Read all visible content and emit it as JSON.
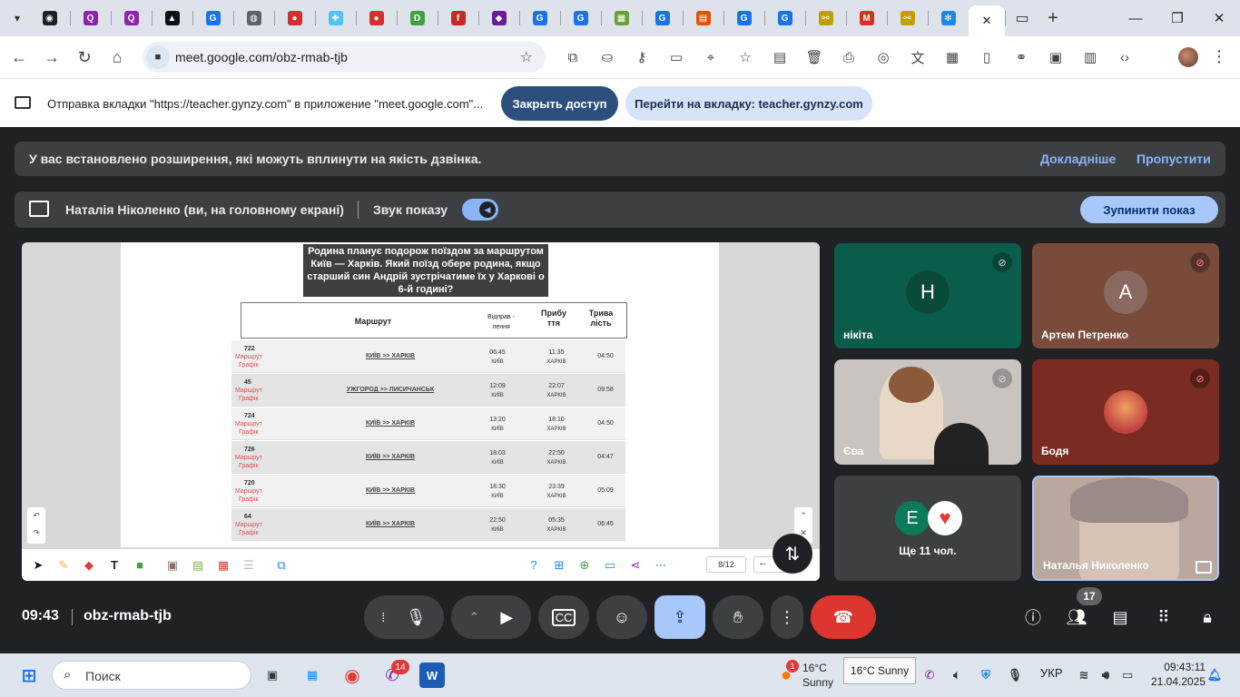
{
  "browser": {
    "tabs": [
      {
        "icon": "robot-icon",
        "glyph": "◉",
        "color": "#202124"
      },
      {
        "icon": "quiz-icon",
        "glyph": "Q",
        "color": "#8e24aa"
      },
      {
        "icon": "quiz-icon",
        "glyph": "Q",
        "color": "#8e24aa"
      },
      {
        "icon": "triangle-icon",
        "glyph": "▲",
        "color": "#111111"
      },
      {
        "icon": "g-icon",
        "glyph": "G",
        "color": "#1a73e8"
      },
      {
        "icon": "globe-icon",
        "glyph": "◍",
        "color": "#5f6368"
      },
      {
        "icon": "ball-icon",
        "glyph": "●",
        "color": "#d32f2f"
      },
      {
        "icon": "puzzle-icon",
        "glyph": "✚",
        "color": "#4fc3f7"
      },
      {
        "icon": "ball-icon",
        "glyph": "●",
        "color": "#d32f2f"
      },
      {
        "icon": "d-icon",
        "glyph": "D",
        "color": "#43a047"
      },
      {
        "icon": "f-icon",
        "glyph": "f",
        "color": "#c62828"
      },
      {
        "icon": "app-icon",
        "glyph": "◆",
        "color": "#6a1b9a"
      },
      {
        "icon": "g-icon",
        "glyph": "G",
        "color": "#1a73e8"
      },
      {
        "icon": "g-icon",
        "glyph": "G",
        "color": "#1a73e8"
      },
      {
        "icon": "grid-icon",
        "glyph": "▦",
        "color": "#689f38"
      },
      {
        "icon": "g-icon",
        "glyph": "G",
        "color": "#1a73e8"
      },
      {
        "icon": "books-icon",
        "glyph": "▤",
        "color": "#e65100"
      },
      {
        "icon": "g-icon",
        "glyph": "G",
        "color": "#1a73e8"
      },
      {
        "icon": "g-icon",
        "glyph": "G",
        "color": "#1a73e8"
      },
      {
        "icon": "link-icon",
        "glyph": "⚯",
        "color": "#c0a000"
      },
      {
        "icon": "gmail-icon",
        "glyph": "M",
        "color": "#d93025"
      },
      {
        "icon": "link-icon",
        "glyph": "⚯",
        "color": "#c0a000"
      },
      {
        "icon": "snowflake-icon",
        "glyph": "✻",
        "color": "#1e88e5"
      }
    ],
    "active_close": "✕",
    "url": "meet.google.com/obz-rmab-tjb"
  },
  "infobar": {
    "message": "Отправка вкладки \"https://teacher.gynzy.com\" в приложение \"meet.google.com\"...",
    "close_access": "Закрыть доступ",
    "go_to_tab": "Перейти на вкладку: teacher.gynzy.com"
  },
  "meet": {
    "banner": {
      "text": "У вас встановлено розширення, які можуть вплинути на якість дзвінка.",
      "learn_more": "Докладніше",
      "skip": "Пропустити"
    },
    "presenting": {
      "presenter": "Наталія Ніколенко (ви, на головному екрані)",
      "sound_label": "Звук показу",
      "stop": "Зупинити показ"
    },
    "slide": {
      "question": "Родина планує подорож поїздом за маршрутом Київ — Харків. Який поїзд обере родина, якщо старший син Андрій зустрічатиме їх у Харкові о 6-й годині?",
      "headers": {
        "route": "Маршрут",
        "departure": "Відправ - лення",
        "arrival": "Прибу ття",
        "duration": "Трива лість"
      },
      "row_labels": {
        "l1": "Маршрут",
        "l2": "Графік"
      },
      "rows": [
        {
          "num": "722",
          "route": "КИЇВ >> ХАРКІВ",
          "dep": "06:45",
          "dep_city": "КИЇВ",
          "arr": "11:35",
          "arr_city": "ХАРКІВ",
          "dur": "04:50"
        },
        {
          "num": "45",
          "route": "УЖГОРОД >> ЛИСИЧАНСЬК",
          "dep": "12:09",
          "dep_city": "КИЇВ",
          "arr": "22:07",
          "arr_city": "ХАРКІВ",
          "dur": "09:58"
        },
        {
          "num": "724",
          "route": "КИЇВ >> ХАРКІВ",
          "dep": "13:20",
          "dep_city": "КИЇВ",
          "arr": "18:10",
          "arr_city": "ХАРКІВ",
          "dur": "04:50"
        },
        {
          "num": "726",
          "route": "КИЇВ >> ХАРКІВ",
          "dep": "18:03",
          "dep_city": "КИЇВ",
          "arr": "22:50",
          "arr_city": "ХАРКІВ",
          "dur": "04:47"
        },
        {
          "num": "720",
          "route": "КИЇВ >> ХАРКІВ",
          "dep": "18:30",
          "dep_city": "КИЇВ",
          "arr": "23:39",
          "arr_city": "ХАРКІВ",
          "dur": "05:09"
        },
        {
          "num": "64",
          "route": "КИЇВ >> ХАРКІВ",
          "dep": "22:50",
          "dep_city": "КИЇВ",
          "arr": "05:35",
          "arr_city": "ХАРКІВ",
          "dur": "06:45"
        }
      ],
      "pager": "8/12"
    },
    "participants": [
      {
        "name": "нікіта",
        "initial": "Н",
        "bg": "#0b5d4b",
        "circle": "#0a4a3b",
        "muted": true
      },
      {
        "name": "Артем Петренко",
        "initial": "А",
        "bg": "#7a4a3a",
        "circle": "#8a6a60",
        "muted": true
      },
      {
        "name": "Єва",
        "initial": "",
        "bg": "#c9c4c0",
        "circle": "",
        "muted": true
      },
      {
        "name": "Бодя",
        "initial": "",
        "bg": "#7a2c22",
        "circle": "",
        "muted": true
      },
      {
        "name": "Наталья Николенко",
        "initial": "",
        "bg": "#b8a8a0",
        "circle": "",
        "muted": false
      }
    ],
    "others": {
      "label": "Ще 11 чол.",
      "initial": "Е"
    },
    "time": "09:43",
    "code": "obz-rmab-tjb",
    "participant_count": "17"
  },
  "taskbar": {
    "search": "Поиск",
    "chat_badge": "14",
    "weather_badge": "1",
    "weather_temp": "16°C",
    "weather_desc": "Sunny",
    "tooltip": "16°C Sunny",
    "lang": "УКР",
    "clock_time": "09:43:11",
    "clock_date": "21.04.2025"
  }
}
